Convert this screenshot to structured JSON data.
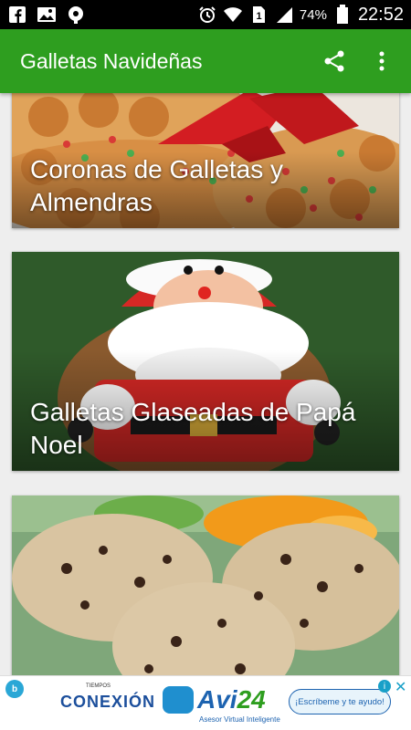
{
  "status_bar": {
    "battery_percent": "74%",
    "time": "22:52",
    "sim_slot": "1",
    "icons": [
      "facebook-icon",
      "gallery-icon",
      "podcast-icon",
      "alarm-icon",
      "wifi-icon",
      "signal-icon",
      "battery-icon"
    ]
  },
  "app_bar": {
    "title": "Galletas Navideñas",
    "actions": [
      "share-icon",
      "overflow-menu-icon"
    ],
    "color": "#2e9e1f"
  },
  "recipes": [
    {
      "title": "Coronas de Galletas y Almendras"
    },
    {
      "title": "Galletas Glaseadas de Papá Noel"
    },
    {
      "title": ""
    }
  ],
  "ad": {
    "left_logo_small": "TIEMPOS",
    "left_logo": "CONEXIÓN",
    "brand": "Avi",
    "brand_suffix": "24",
    "tagline": "Asesor Virtual Inteligente",
    "cta": "¡Escríbeme y te ayudo!"
  }
}
